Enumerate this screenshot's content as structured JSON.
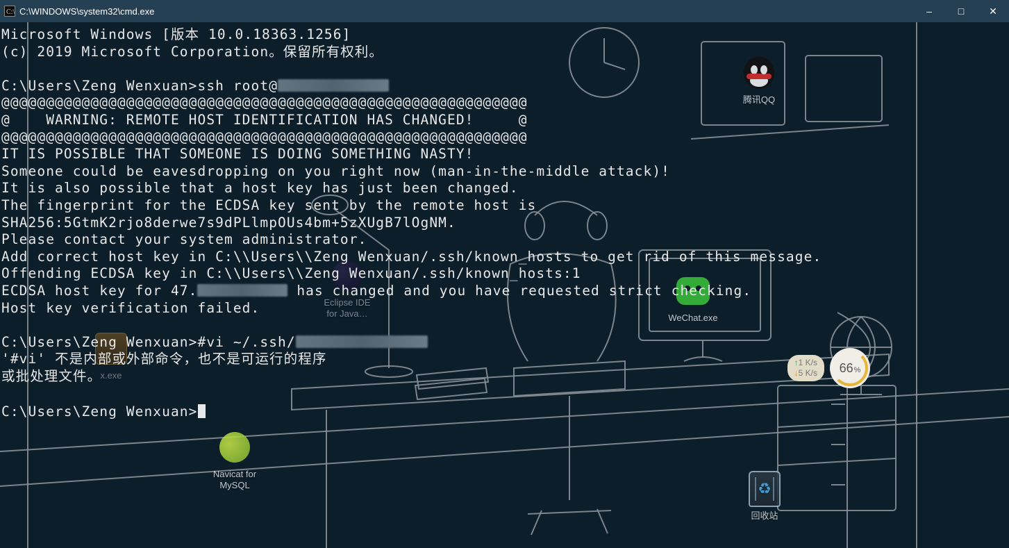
{
  "window": {
    "title": "C:\\WINDOWS\\system32\\cmd.exe"
  },
  "terminal": {
    "lines": [
      "Microsoft Windows [版本 10.0.18363.1256]",
      "(c) 2019 Microsoft Corporation。保留所有权利。",
      "",
      "__PROMPT__ssh root@__BLUR_W1__",
      "@@@@@@@@@@@@@@@@@@@@@@@@@@@@@@@@@@@@@@@@@@@@@@@@@@@@@@@@@@@",
      "@    WARNING: REMOTE HOST IDENTIFICATION HAS CHANGED!     @",
      "@@@@@@@@@@@@@@@@@@@@@@@@@@@@@@@@@@@@@@@@@@@@@@@@@@@@@@@@@@@",
      "IT IS POSSIBLE THAT SOMEONE IS DOING SOMETHING NASTY!",
      "Someone could be eavesdropping on you right now (man-in-the-middle attack)!",
      "It is also possible that a host key has just been changed.",
      "The fingerprint for the ECDSA key sent by the remote host is",
      "SHA256:5GtmK2rjo8derwe7s9dPLlmpOUs4bm+5zXUgB7lOgNM.",
      "Please contact your system administrator.",
      "Add correct host key in C:\\\\Users\\\\Zeng Wenxuan/.ssh/known_hosts to get rid of this message.",
      "Offending ECDSA key in C:\\\\Users\\\\Zeng Wenxuan/.ssh/known_hosts:1",
      "ECDSA host key for 47.__BLUR_W2__ has changed and you have requested strict checking.",
      "Host key verification failed.",
      "",
      "__PROMPT__#vi ~/.ssh/__BLUR_W3__",
      "'#vi' 不是内部或外部命令，也不是可运行的程序",
      "或批处理文件。",
      "",
      "__PROMPT____CURSOR__"
    ],
    "prompt": "C:\\Users\\Zeng Wenxuan>"
  },
  "desktop": {
    "icons": {
      "qq": {
        "label": "腾讯QQ"
      },
      "wechat": {
        "label": "WeChat.exe"
      },
      "recycle": {
        "label": "回收站"
      },
      "navicat": {
        "label": "Navicat for\nMySQL"
      },
      "eclipse": {
        "label": "Eclipse IDE\nfor Java…"
      },
      "xexe": {
        "label": "x.exe"
      }
    },
    "net": {
      "up": "1  K/s",
      "down": "5  K/s",
      "mem_percent": "66",
      "mem_unit": "%"
    }
  }
}
